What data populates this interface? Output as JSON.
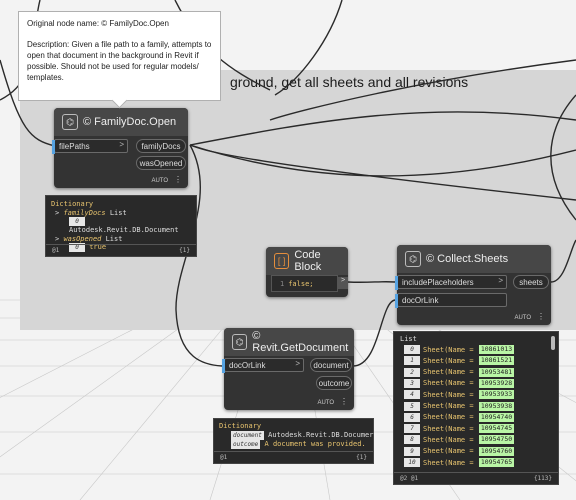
{
  "group": {
    "title": "ground, get all sheets and all revisions"
  },
  "tooltip": {
    "title": "Original node name:  © FamilyDoc.Open",
    "description": "Description:  Given a file path to a family, attempts to open that document in the background in Revit if possible. Should not be used for regular models/ templates."
  },
  "nodes": {
    "familyDocOpen": {
      "title": "© FamilyDoc.Open",
      "input": "filePaths",
      "outputs": [
        "familyDocs",
        "wasOpened"
      ],
      "footer": "AUTO"
    },
    "codeBlock": {
      "title": "Code Block",
      "line_no": "1",
      "code": "false;"
    },
    "collectSheets": {
      "title": "© Collect.Sheets",
      "inputs": [
        "includePlaceholders",
        "docOrLink"
      ],
      "output": "sheets",
      "footer": "AUTO"
    },
    "getDocument": {
      "title": "© Revit.GetDocument",
      "input": "docOrLink",
      "outputs": [
        "document",
        "outcome"
      ],
      "footer": "AUTO"
    }
  },
  "previews": {
    "dictionary1": {
      "header": "Dictionary",
      "key1": "familyDocs",
      "key1_type": "List",
      "item_index": "0",
      "item_value": "Autodesk.Revit.DB.Document",
      "key2": "wasOpened",
      "key2_type": "List",
      "item2_index": "0",
      "item2_value": "true",
      "footer_left": "@1",
      "footer_right": "{1}"
    },
    "dictionary2": {
      "header": "Dictionary",
      "key1": "document",
      "val1": "Autodesk.Revit.DB.Documer",
      "key2": "outcome",
      "val2": "A document was provided.",
      "footer_left": "@1",
      "footer_right": "{1}"
    },
    "sheetList": {
      "header": "List",
      "items": [
        {
          "index": "0",
          "label": "Sheet(Name = )",
          "value": "10861013"
        },
        {
          "index": "1",
          "label": "Sheet(Name = )",
          "value": "10861521"
        },
        {
          "index": "2",
          "label": "Sheet(Name = )",
          "value": "10953481"
        },
        {
          "index": "3",
          "label": "Sheet(Name = )",
          "value": "10953928"
        },
        {
          "index": "4",
          "label": "Sheet(Name = )",
          "value": "10953933"
        },
        {
          "index": "5",
          "label": "Sheet(Name = )",
          "value": "10953938"
        },
        {
          "index": "6",
          "label": "Sheet(Name = )",
          "value": "10954740"
        },
        {
          "index": "7",
          "label": "Sheet(Name = )",
          "value": "10954745"
        },
        {
          "index": "8",
          "label": "Sheet(Name = )",
          "value": "10954750"
        },
        {
          "index": "9",
          "label": "Sheet(Name = )",
          "value": "10954760"
        },
        {
          "index": "10",
          "label": "Sheet(Name = )",
          "value": "10954765"
        }
      ],
      "footer_left": "@2 @1",
      "footer_right": "{113}"
    }
  },
  "colors": {
    "wire": "#2a2a2a",
    "port": "#56a3e2",
    "highlight": "#b9f5a5"
  }
}
